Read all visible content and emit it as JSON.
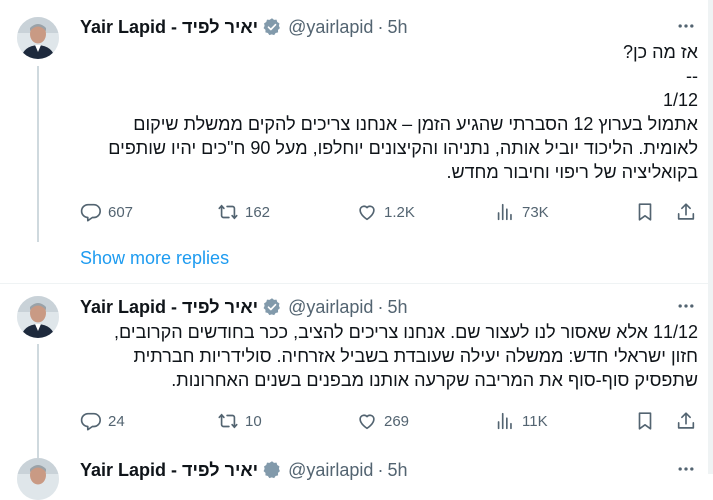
{
  "tweets": [
    {
      "name": "יאיר לפיד - Yair Lapid",
      "handle": "@yairlapid",
      "sep": "·",
      "time": "5h",
      "lines": [
        "אז מה כן?",
        "--",
        "1/12",
        "אתמול בערוץ 12 הסברתי שהגיע הזמן – אנחנו צריכים להקים ממשלת שיקום",
        "לאומית. הליכוד יוביל אותה, נתניהו והקיצונים יוחלפו, מעל 90 ח\"כים יהיו שותפים",
        "בקואליציה של ריפוי וחיבור מחדש."
      ],
      "reply_count": "607",
      "retweet_count": "162",
      "like_count": "1.2K",
      "view_count": "73K"
    },
    {
      "name": "יאיר לפיד - Yair Lapid",
      "handle": "@yairlapid",
      "sep": "·",
      "time": "5h",
      "lines": [
        "11/12 אלא שאסור לנו לעצור שם. אנחנו צריכים להציב, ככר בחודשים הקרובים,",
        "חזון ישראלי חדש: ממשלה יעילה שעובדת בשביל אזרחיה. סולידריות חברתית",
        "שתפסיק סוף-סוף את המריבה שקרעה אותנו מבפנים בשנים האחרונות."
      ],
      "reply_count": "24",
      "retweet_count": "10",
      "like_count": "269",
      "view_count": "11K"
    },
    {
      "name": "יאיר לפיד - Yair Lapid",
      "handle": "@yairlapid",
      "sep": "·",
      "time": "5h"
    }
  ],
  "show_more_label": "Show more replies",
  "colors": {
    "accent": "#1d9bf0",
    "text": "#0f1419",
    "secondary": "#536471",
    "line": "#cfd9de"
  },
  "icons": [
    "more-icon",
    "verified-icon",
    "reply-icon",
    "retweet-icon",
    "like-icon",
    "views-icon",
    "bookmark-icon",
    "share-icon"
  ]
}
